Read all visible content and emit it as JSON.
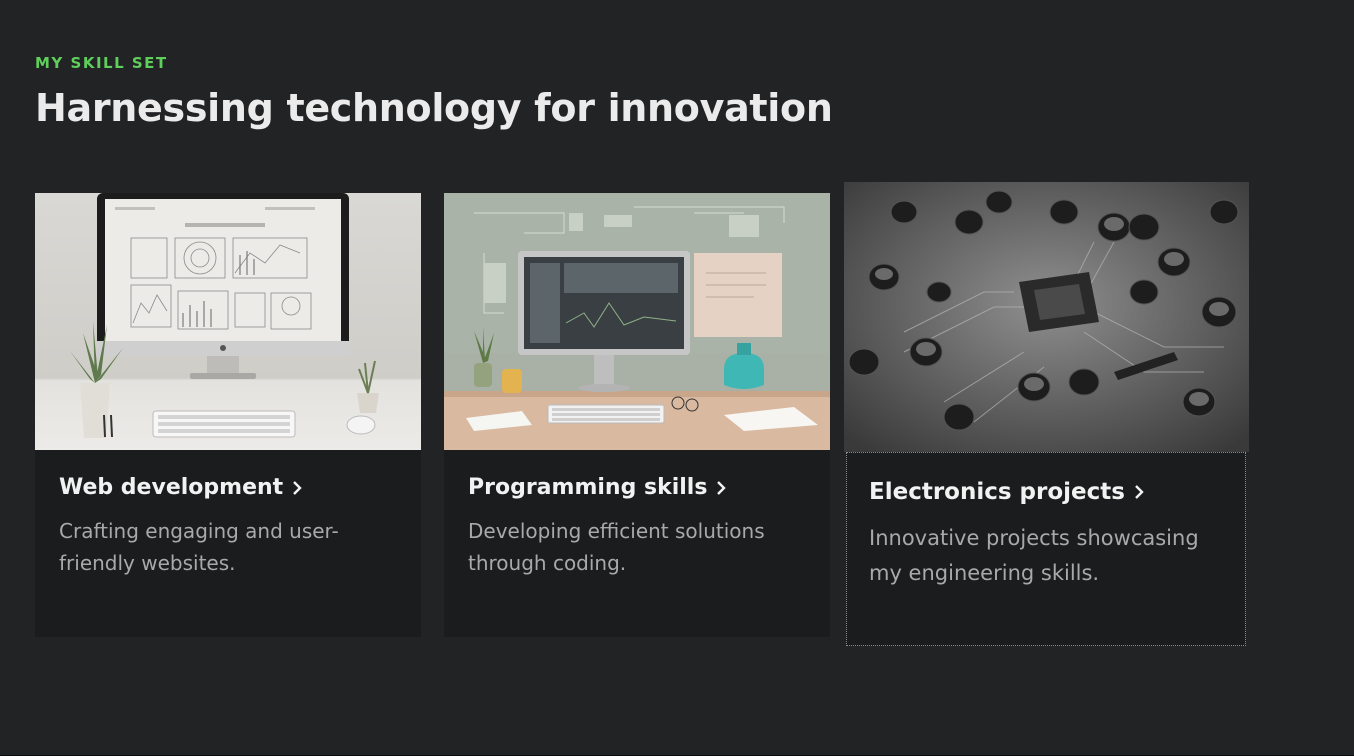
{
  "section": {
    "eyebrow": "MY SKILL SET",
    "heading": "Harnessing technology for innovation",
    "accent_color": "#5fcf5b"
  },
  "cards": [
    {
      "title": "Web development",
      "description": "Crafting engaging and user-friendly websites.",
      "image_alt": "desk with monitor showing charts"
    },
    {
      "title": "Programming skills",
      "description": "Developing efficient solutions through coding.",
      "image_alt": "desk with computer displaying code"
    },
    {
      "title": "Electronics projects",
      "description": "Innovative projects showcasing my engineering skills.",
      "image_alt": "close-up of circuit board with capacitors"
    }
  ]
}
